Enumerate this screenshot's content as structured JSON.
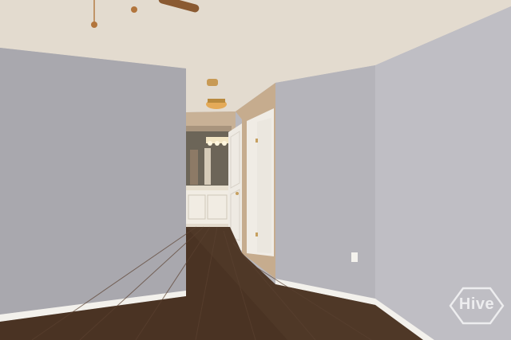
{
  "photo": {
    "subject": "empty-room-hallway-view",
    "colors": {
      "ceiling": "#e6ded3",
      "left_wall": "#a8a7ad",
      "right_wall_far": "#b6b5bb",
      "right_wall_near": "#c1c0c6",
      "hall_wall": "#c9b49a",
      "floor": "#4b3525",
      "baseboard": "#f4f2ee",
      "door": "#eeeae3",
      "light_fixture": "#d9a24f"
    }
  },
  "watermark": {
    "text": "Hive"
  }
}
